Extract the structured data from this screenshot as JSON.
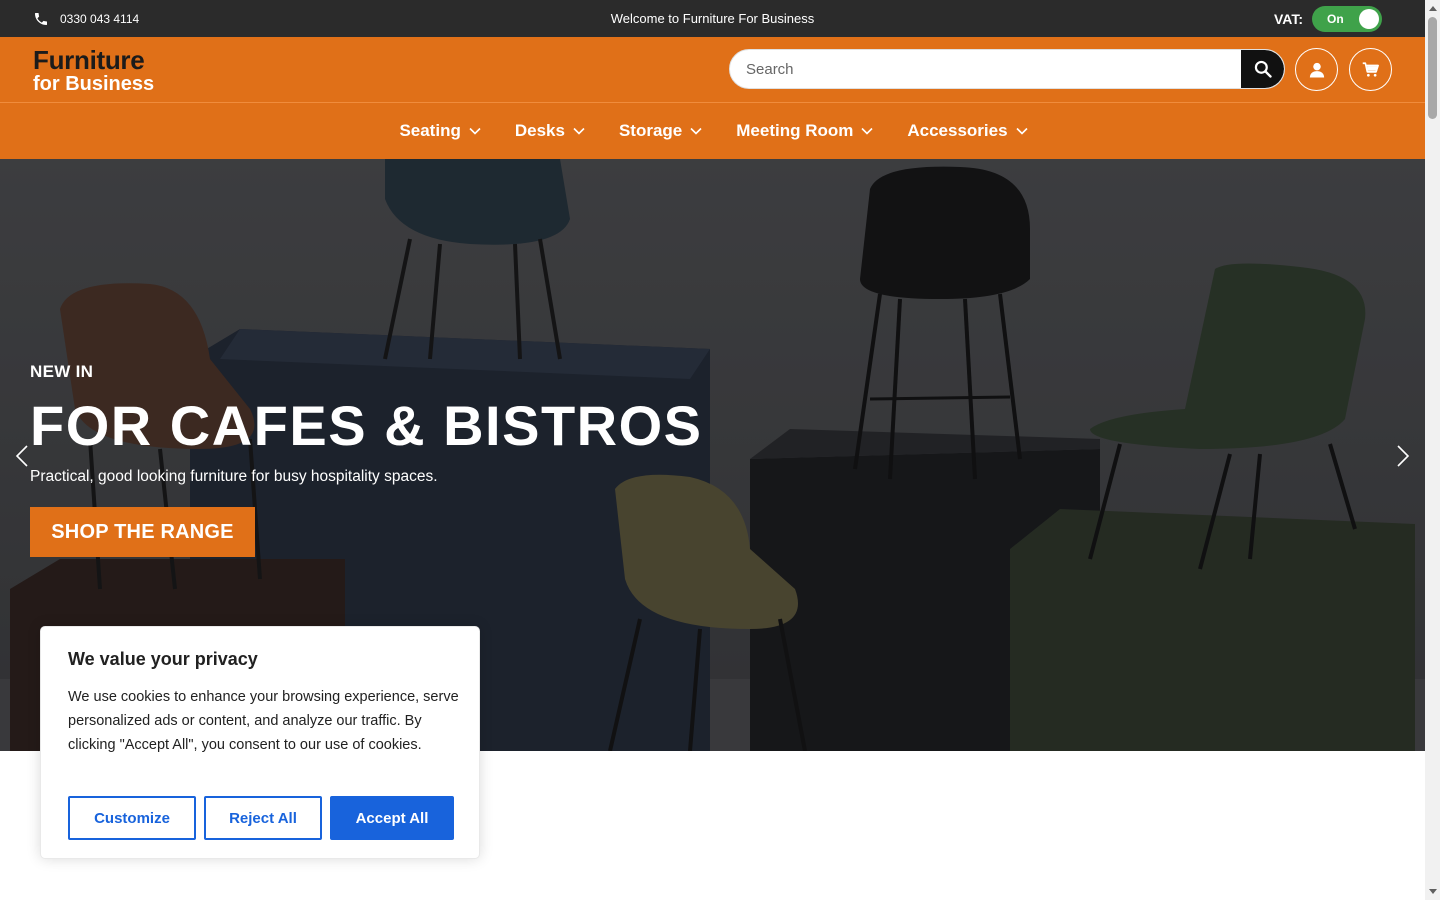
{
  "topbar": {
    "phone": "0330 043 4114",
    "welcome": "Welcome to Furniture For Business",
    "vat_label": "VAT:",
    "vat_toggle": "On"
  },
  "header": {
    "logo_line1": "Furniture",
    "logo_line2": "for Business",
    "search_placeholder": "Search"
  },
  "nav": {
    "items": [
      {
        "label": "Seating"
      },
      {
        "label": "Desks"
      },
      {
        "label": "Storage"
      },
      {
        "label": "Meeting Room"
      },
      {
        "label": "Accessories"
      }
    ]
  },
  "hero": {
    "eyebrow": "NEW IN",
    "headline": "FOR CAFES & BISTROS",
    "subtext": "Practical, good looking furniture for busy hospitality spaces.",
    "cta": "SHOP THE RANGE"
  },
  "cookie": {
    "title": "We value your privacy",
    "body": "We use cookies to enhance your browsing experience, serve personalized ads or content, and analyze our traffic. By clicking \"Accept All\", you consent to our use of cookies.",
    "customize": "Customize",
    "reject": "Reject All",
    "accept": "Accept All"
  },
  "colors": {
    "brand_orange": "#e07018",
    "topbar": "#2b2b2b",
    "toggle_on": "#3fa24a",
    "cookie_blue": "#1863dc"
  }
}
